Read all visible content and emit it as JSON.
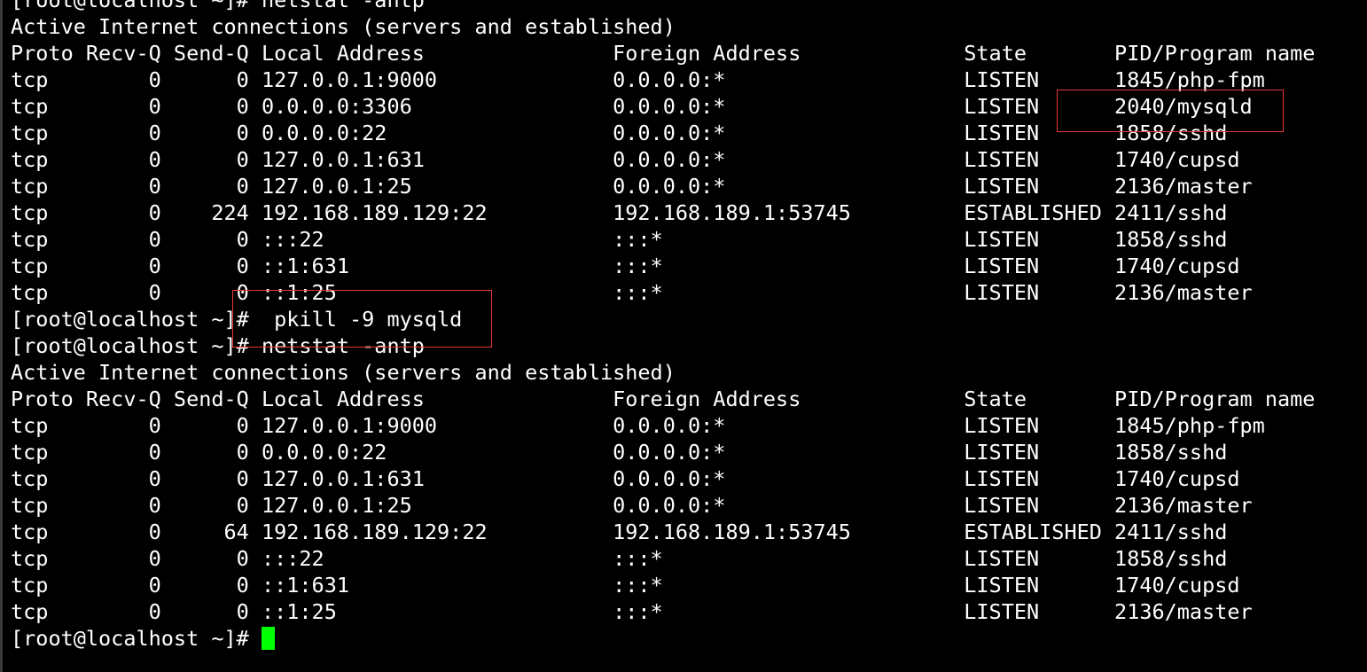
{
  "terminal": {
    "lines": [
      "[root@localhost ~]# netstat -antp",
      "Active Internet connections (servers and established)",
      "Proto Recv-Q Send-Q Local Address               Foreign Address             State       PID/Program name",
      "tcp        0      0 127.0.0.1:9000              0.0.0.0:*                   LISTEN      1845/php-fpm",
      "tcp        0      0 0.0.0.0:3306                0.0.0.0:*                   LISTEN      2040/mysqld",
      "tcp        0      0 0.0.0.0:22                  0.0.0.0:*                   LISTEN      1858/sshd",
      "tcp        0      0 127.0.0.1:631               0.0.0.0:*                   LISTEN      1740/cupsd",
      "tcp        0      0 127.0.0.1:25                0.0.0.0:*                   LISTEN      2136/master",
      "tcp        0    224 192.168.189.129:22          192.168.189.1:53745         ESTABLISHED 2411/sshd",
      "tcp        0      0 :::22                       :::*                        LISTEN      1858/sshd",
      "tcp        0      0 ::1:631                     :::*                        LISTEN      1740/cupsd",
      "tcp        0      0 ::1:25                      :::*                        LISTEN      2136/master",
      "[root@localhost ~]#  pkill -9 mysqld",
      "[root@localhost ~]# netstat -antp",
      "Active Internet connections (servers and established)",
      "Proto Recv-Q Send-Q Local Address               Foreign Address             State       PID/Program name",
      "tcp        0      0 127.0.0.1:9000              0.0.0.0:*                   LISTEN      1845/php-fpm",
      "tcp        0      0 0.0.0.0:22                  0.0.0.0:*                   LISTEN      1858/sshd",
      "tcp        0      0 127.0.0.1:631               0.0.0.0:*                   LISTEN      1740/cupsd",
      "tcp        0      0 127.0.0.1:25                0.0.0.0:*                   LISTEN      2136/master",
      "tcp        0     64 192.168.189.129:22          192.168.189.1:53745         ESTABLISHED 2411/sshd",
      "tcp        0      0 :::22                       :::*                        LISTEN      1858/sshd",
      "tcp        0      0 ::1:631                     :::*                        LISTEN      1740/cupsd",
      "tcp        0      0 ::1:25                      :::*                        LISTEN      2136/master"
    ],
    "prompt": "[root@localhost ~]# "
  },
  "colors": {
    "background": "#000000",
    "text": "#ffffff",
    "cursor": "#00ff00",
    "annotation": "#e8373a"
  }
}
